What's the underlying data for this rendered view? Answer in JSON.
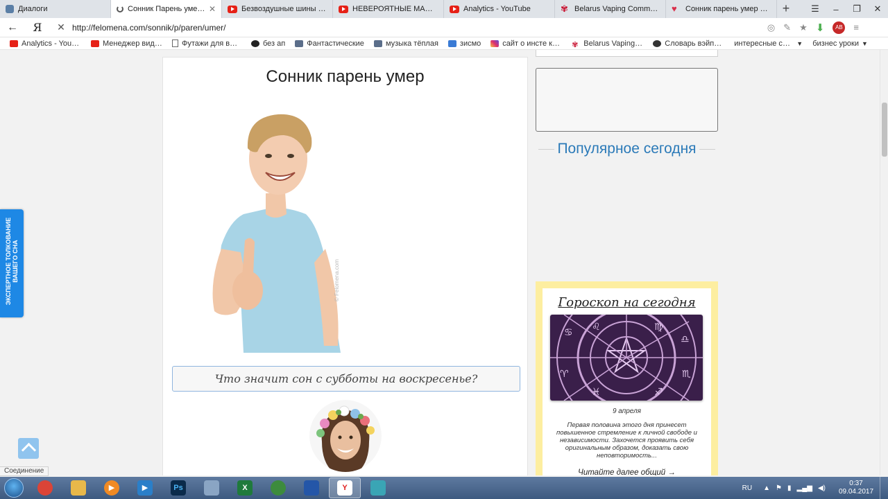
{
  "tabs": [
    {
      "title": "Диалоги",
      "icon": "vk-icon",
      "active": false
    },
    {
      "title": "Сонник Парень умер к чему",
      "icon": "loading-icon",
      "active": true
    },
    {
      "title": "Безвоздушные шины на ро",
      "icon": "youtube-icon",
      "active": false
    },
    {
      "title": "НЕВЕРОЯТНЫЕ МАШИНЫ, к",
      "icon": "youtube-icon",
      "active": false
    },
    {
      "title": "Analytics - YouTube",
      "icon": "youtube-icon",
      "active": false
    },
    {
      "title": "Belarus Vaping Community",
      "icon": "belarus-icon",
      "active": false
    },
    {
      "title": "Сонник парень умер к чем",
      "icon": "heart-icon",
      "active": false
    }
  ],
  "address": {
    "url": "http://felomena.com/sonnik/p/paren/umer/",
    "yandex_label": "Я",
    "back_glyph": "←",
    "stop_glyph": "✕",
    "ext_badge": "AB"
  },
  "bookmarks": [
    {
      "label": "Analytics - YouTub",
      "icon": "youtube-icon"
    },
    {
      "label": "Менеджер видео",
      "icon": "youtube-icon"
    },
    {
      "label": "Футажи для виде",
      "icon": "document-icon"
    },
    {
      "label": "без ап",
      "icon": "disk-icon"
    },
    {
      "label": "Фантастические",
      "icon": "wi-icon"
    },
    {
      "label": "музыка тёплая",
      "icon": "pause-icon"
    },
    {
      "label": "зисмо",
      "icon": "z-icon"
    },
    {
      "label": "сайт о инсте крут",
      "icon": "instagram-icon"
    },
    {
      "label": "Belarus Vaping Co",
      "icon": "belarus-icon"
    },
    {
      "label": "Словарь вэйпера",
      "icon": "dark-icon"
    },
    {
      "label": "интересные ссылк",
      "icon": "folder-icon",
      "caret": "▼"
    },
    {
      "label": "бизнес уроки",
      "icon": "folder-icon",
      "caret": "▼"
    }
  ],
  "article": {
    "title": "Сонник парень умер",
    "watermark": "© Felomena.com",
    "question_button": "Что значит сон с субботы на воскресенье?"
  },
  "sidebar": {
    "popular_heading": "Популярное сегодня",
    "horoscope": {
      "title": "Гороскоп на сегодня",
      "date": "9 апреля",
      "text": "Первая половина этого дня принесет повышенное стремление к личной свободе и независимости. Захочется проявить себя оригинальным образом, доказать свою неповторимость...",
      "more_link": "Читайте далее общий →"
    }
  },
  "side_tab": {
    "label": "ЭКСПЕРТНОЕ ТОЛКОВАНИЕ ВАШЕГО СНА"
  },
  "status_bar": {
    "text": "Соединение"
  },
  "taskbar": {
    "apps": [
      {
        "name": "chrome",
        "color": "#db4437"
      },
      {
        "name": "explorer",
        "color": "#e8b84a"
      },
      {
        "name": "media-player",
        "color": "#f08a24"
      },
      {
        "name": "media-player-2",
        "color": "#2a7fc9"
      },
      {
        "name": "photoshop",
        "color": "#0a2a4a",
        "label": "Ps"
      },
      {
        "name": "calculator",
        "color": "#8aa5c4"
      },
      {
        "name": "excel",
        "color": "#1f7a3c",
        "label": "X"
      },
      {
        "name": "tree-app",
        "color": "#3d8b3d"
      },
      {
        "name": "save-app",
        "color": "#2456a8"
      },
      {
        "name": "yandex",
        "color": "#ffffff",
        "label": "Y"
      },
      {
        "name": "vape-app",
        "color": "#3aa5b5"
      }
    ],
    "language": "RU",
    "time": "0:37",
    "date": "09.04.2017"
  },
  "colors": {
    "accent": "#2b7ab8",
    "side_tab": "#1e88e5",
    "horoscope_frame": "#fdeea0"
  }
}
